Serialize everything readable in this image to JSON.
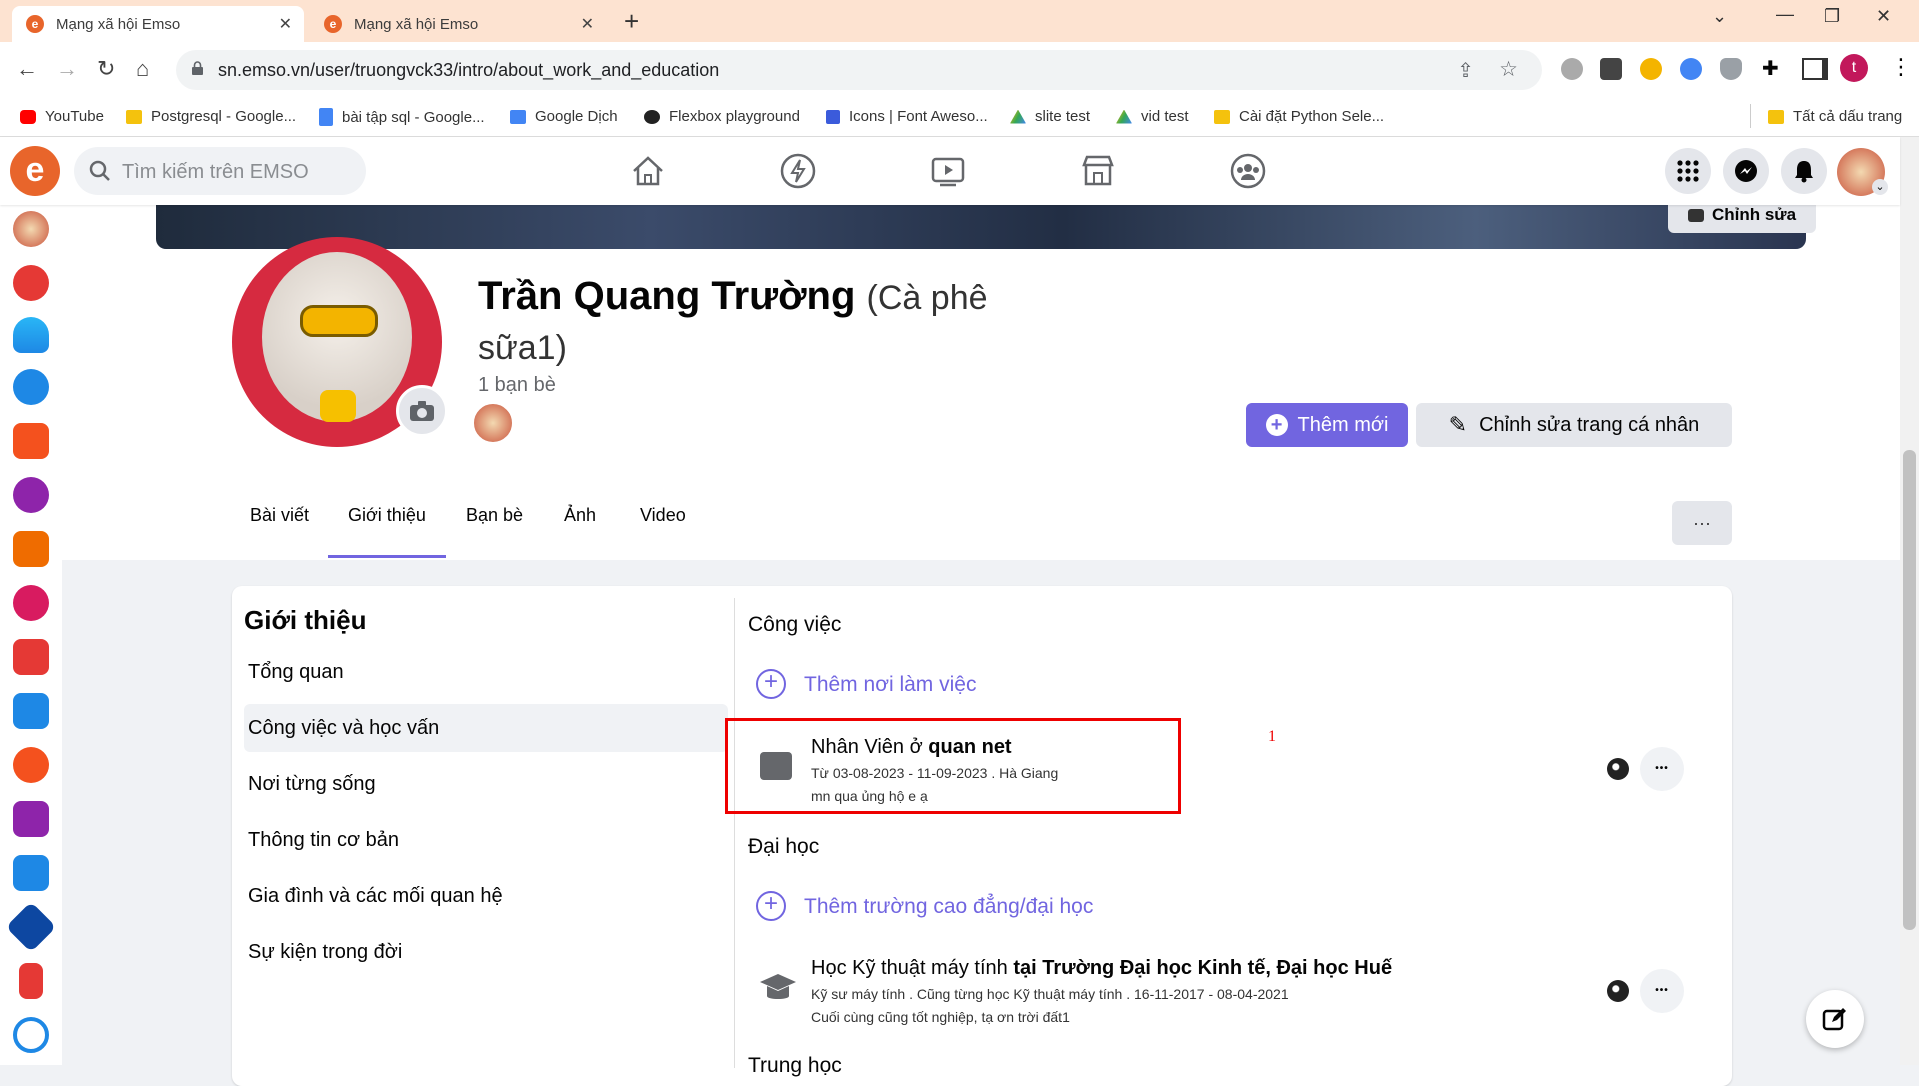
{
  "browser": {
    "tabs": [
      {
        "title": "Mạng xã hội Emso"
      },
      {
        "title": "Mạng xã hội Emso"
      }
    ],
    "new_tab": "+",
    "url": "sn.emso.vn/user/truongvck33/intro/about_work_and_education",
    "profile_letter": "t",
    "bookmarks": [
      {
        "label": "YouTube",
        "color": "#ff0000"
      },
      {
        "label": "Postgresql - Google...",
        "color": "#f4c20d"
      },
      {
        "label": "bài tập sql - Google...",
        "color": "#4285f4"
      },
      {
        "label": "Google Dịch",
        "color": "#4285f4"
      },
      {
        "label": "Flexbox playground",
        "color": "#222222"
      },
      {
        "label": "Icons | Font Aweso...",
        "color": "#3b5bdb"
      },
      {
        "label": "slite test",
        "color": "#34a853"
      },
      {
        "label": "vid test",
        "color": "#34a853"
      },
      {
        "label": "Cài đặt Python Sele...",
        "color": "#f4c20d"
      }
    ],
    "all_bookmarks": "Tất cả dấu trang"
  },
  "app": {
    "search_placeholder": "Tìm kiếm trên EMSO",
    "brand_color": "#e8652b",
    "accent_color": "#7165e0"
  },
  "profile": {
    "edit_cover": "Chỉnh sửa",
    "name": "Trần Quang Trường",
    "nickname": "(Cà phê sữa1)",
    "friends_count": "1 bạn bè",
    "add_new": "Thêm mới",
    "edit_profile": "Chỉnh sửa trang cá nhân",
    "tabs": [
      "Bài viết",
      "Giới thiệu",
      "Bạn bè",
      "Ảnh",
      "Video"
    ],
    "active_tab": "Giới thiệu",
    "more": "···"
  },
  "intro": {
    "heading": "Giới thiệu",
    "menu": [
      "Tổng quan",
      "Công việc và học vấn",
      "Nơi từng sống",
      "Thông tin cơ bản",
      "Gia đình và các mối quan hệ",
      "Sự kiện trong đời"
    ],
    "work_heading": "Công việc",
    "add_work": "Thêm nơi làm việc",
    "work": {
      "title_prefix": "Nhân Viên ở ",
      "title_place": "quan net",
      "dates": "Từ 03-08-2023 - 11-09-2023 . Hà Giang",
      "description": "mn qua ủng hộ e ạ"
    },
    "annotation": "1",
    "university_heading": "Đại học",
    "add_university": "Thêm trường cao đẳng/đại học",
    "university": {
      "title_prefix": "Học Kỹ thuật máy tính ",
      "title_place": "tại Trường Đại học Kinh tế, Đại học Huế",
      "details": "Kỹ sư máy tính . Cũng từng học Kỹ thuật máy tính . 16-11-2017 - 08-04-2021",
      "description": "Cuối cùng cũng tốt nghiệp, tạ ơn trời đất1"
    },
    "more_dots": "•••",
    "next_heading_partial": "Trung học"
  }
}
